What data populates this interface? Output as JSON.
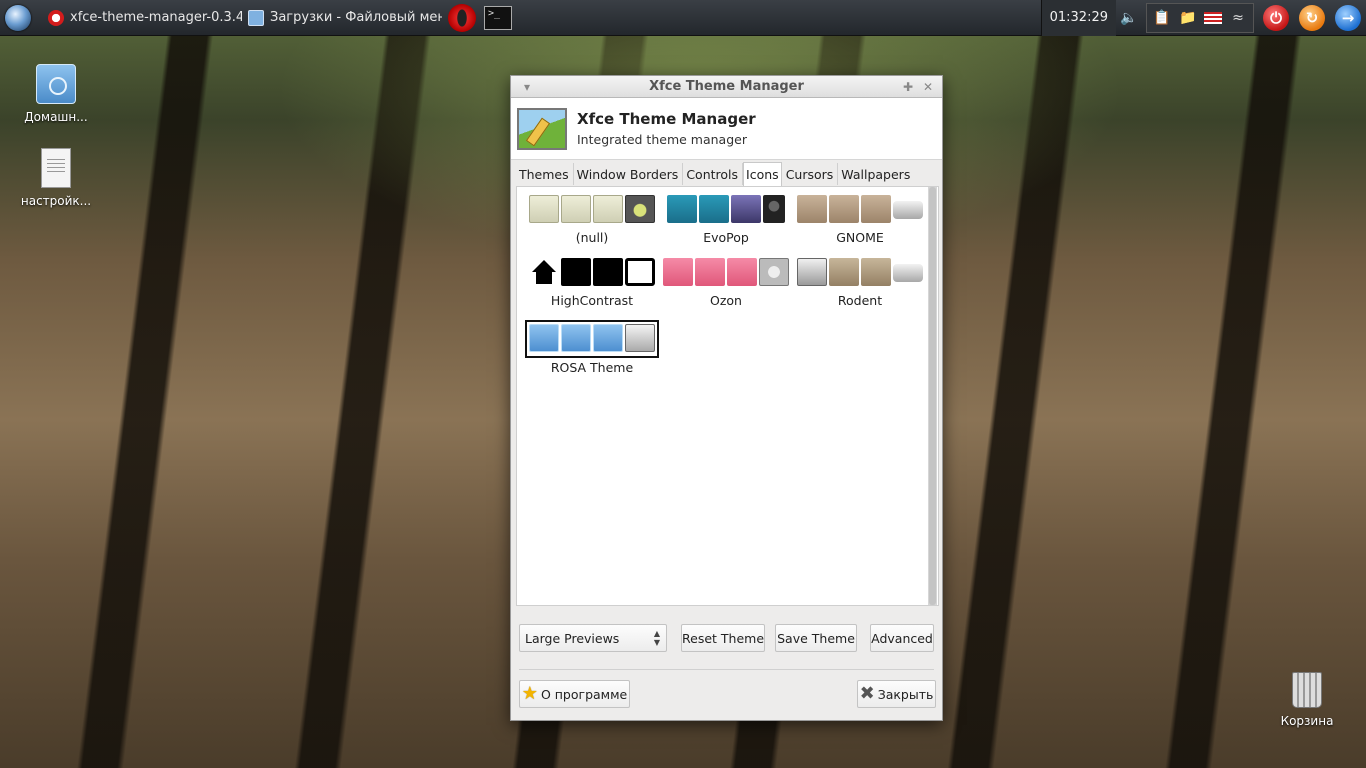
{
  "taskbar": {
    "tasks": [
      {
        "label": "xfce-theme-manager-0.3.4..."
      },
      {
        "label": "Загрузки - Файловый мен..."
      }
    ],
    "clock": "01:32:29"
  },
  "desktop": {
    "icons": [
      {
        "label": "Домашн..."
      },
      {
        "label": "настройк..."
      },
      {
        "label": "Корзина"
      }
    ]
  },
  "window": {
    "title": "Xfce Theme Manager",
    "header_title": "Xfce Theme Manager",
    "header_subtitle": "Integrated theme manager",
    "tabs": [
      {
        "label": "Themes"
      },
      {
        "label": "Window Borders"
      },
      {
        "label": "Controls"
      },
      {
        "label": "Icons"
      },
      {
        "label": "Cursors"
      },
      {
        "label": "Wallpapers"
      }
    ],
    "active_tab": "Icons",
    "themes": [
      {
        "label": "(null)"
      },
      {
        "label": "EvoPop"
      },
      {
        "label": "GNOME"
      },
      {
        "label": "HighContrast"
      },
      {
        "label": "Ozon"
      },
      {
        "label": "Rodent"
      },
      {
        "label": "ROSA Theme",
        "selected": true
      }
    ],
    "preview_select": "Large Previews",
    "buttons": {
      "reset": "Reset Theme",
      "save": "Save Theme",
      "advanced": "Advanced",
      "about": "О программе",
      "close": "Закрыть"
    }
  }
}
